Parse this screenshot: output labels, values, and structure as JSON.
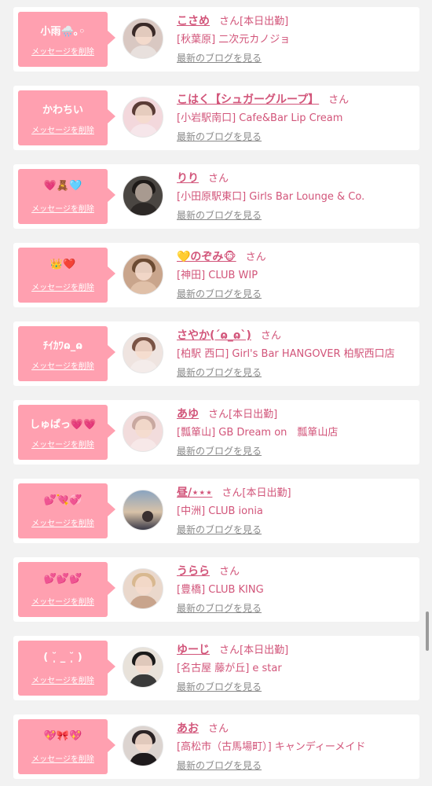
{
  "colors": {
    "accent_pink": "#ffa0b0",
    "name_text": "#d2557a",
    "link_gray": "#8a8a8a",
    "page_bg": "#f2f2f2"
  },
  "strings": {
    "delete_label": "メッセージを削除",
    "san": "さん",
    "blog_link": "最新のブログを見る"
  },
  "items": [
    {
      "message": "小雨🌧️｡◦",
      "name": "こさめ",
      "duty": "[本日出勤]",
      "shop": "[秋葉原] 二次元カノジョ"
    },
    {
      "message": "かわちい",
      "name": "こはく【シュガーグループ】",
      "duty": "",
      "shop": "[小岩駅南口] Cafe&Bar Lip Cream"
    },
    {
      "message": "💗🧸🩵",
      "name": "りり",
      "duty": "",
      "shop": "[小田原駅東口] Girls Bar Lounge & Co."
    },
    {
      "message": "👑❤️",
      "name": "💛のぞみ🐵",
      "duty": "",
      "shop": "[神田] CLUB WIP"
    },
    {
      "message": "ﾁｲｶﾜɷ_ɷ",
      "name": "さやか(ˊɷ_ɷˋ)",
      "duty": "",
      "shop": "[柏駅 西口] Girl's Bar HANGOVER 柏駅西口店"
    },
    {
      "message": "しゅぱっ💗💗",
      "name": "あゆ",
      "duty": "[本日出勤]",
      "shop": "[瓢箪山] GB Dream on　瓢箪山店"
    },
    {
      "message": "💕💘💞",
      "name": "昼/⋆⋆⋆",
      "duty": "[本日出勤]",
      "shop": "[中洲] CLUB ionia"
    },
    {
      "message": "💕💕💕",
      "name": "うらら",
      "duty": "",
      "shop": "[豊橋] CLUB KING"
    },
    {
      "message": "( ˘̩̩ _ ˘̩̩ )",
      "name": "ゆーじ",
      "duty": "[本日出勤]",
      "shop": "[名古屋 藤が丘] e star"
    },
    {
      "message": "💖🎀💖",
      "name": "あお",
      "duty": "",
      "shop": "[高松市（古馬場町）] キャンディーメイド"
    }
  ]
}
